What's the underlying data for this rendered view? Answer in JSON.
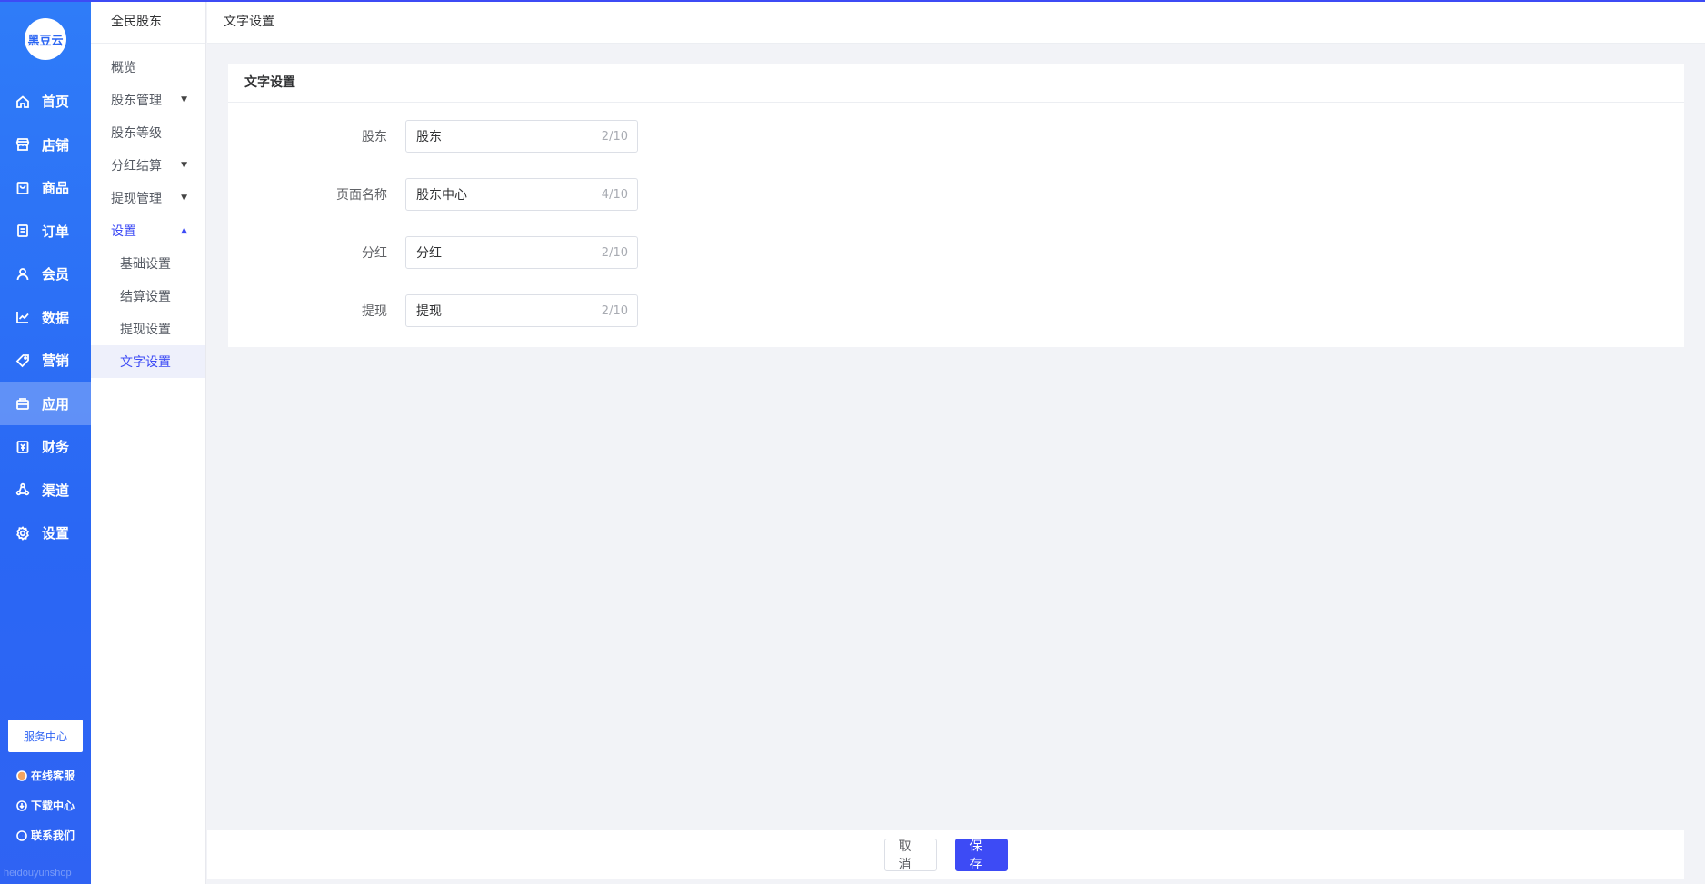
{
  "colors": {
    "accent": "#3d4bf5",
    "nav_blue": "#2d67f3"
  },
  "nav": {
    "logo_text": "黑豆云",
    "items": [
      {
        "label": "首页",
        "icon": "home-icon"
      },
      {
        "label": "店铺",
        "icon": "store-icon"
      },
      {
        "label": "商品",
        "icon": "goods-icon"
      },
      {
        "label": "订单",
        "icon": "order-icon"
      },
      {
        "label": "会员",
        "icon": "user-icon"
      },
      {
        "label": "数据",
        "icon": "chart-icon"
      },
      {
        "label": "营销",
        "icon": "tag-icon"
      },
      {
        "label": "应用",
        "icon": "app-icon",
        "active": true
      },
      {
        "label": "财务",
        "icon": "finance-icon"
      },
      {
        "label": "渠道",
        "icon": "channel-icon"
      },
      {
        "label": "设置",
        "icon": "gear-icon"
      }
    ],
    "service_center": "服务中心",
    "footer": [
      {
        "label": "在线客服",
        "icon": "avatar-icon"
      },
      {
        "label": "下载中心",
        "icon": "download-icon"
      },
      {
        "label": "联系我们",
        "icon": "chat-icon"
      }
    ],
    "watermark": "heidouyunshop"
  },
  "subnav": {
    "title": "全民股东",
    "items": [
      {
        "label": "概览"
      },
      {
        "label": "股东管理"
      },
      {
        "label": "股东等级"
      },
      {
        "label": "分红结算"
      },
      {
        "label": "提现管理"
      },
      {
        "label": "设置"
      }
    ],
    "settings_children": [
      {
        "label": "基础设置"
      },
      {
        "label": "结算设置"
      },
      {
        "label": "提现设置"
      },
      {
        "label": "文字设置"
      }
    ]
  },
  "breadcrumb": "文字设置",
  "card": {
    "title": "文字设置",
    "fields": [
      {
        "label": "股东",
        "value": "股东",
        "count": "2/10"
      },
      {
        "label": "页面名称",
        "value": "股东中心",
        "count": "4/10"
      },
      {
        "label": "分红",
        "value": "分红",
        "count": "2/10"
      },
      {
        "label": "提现",
        "value": "提现",
        "count": "2/10"
      }
    ]
  },
  "footer": {
    "cancel": "取消",
    "save": "保存"
  }
}
